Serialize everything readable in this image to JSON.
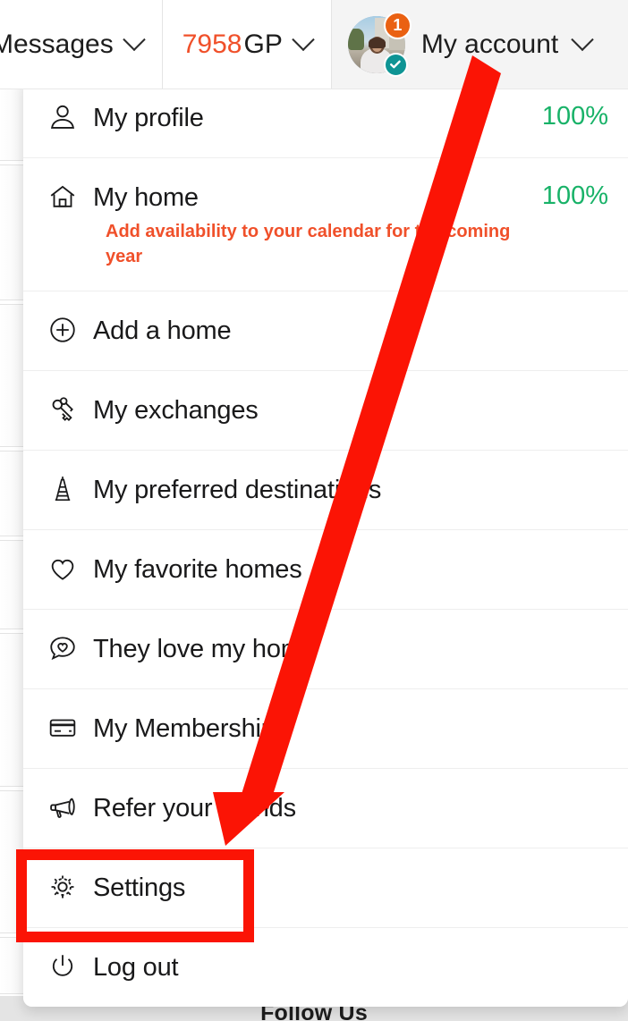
{
  "header": {
    "messages_label": "Messages",
    "gp_value": "7958",
    "gp_unit": "GP",
    "account_label": "My account",
    "avatar_badge_count": "1",
    "verified_icon": "check-icon",
    "messages_chevron": "chevron-down-icon",
    "gp_chevron": "chevron-down-icon",
    "account_chevron": "chevron-down-icon"
  },
  "dropdown": {
    "items": [
      {
        "label": "My profile",
        "icon": "user-icon",
        "meta": "100%"
      },
      {
        "label": "My home",
        "icon": "house-icon",
        "meta": "100%",
        "note": "Add availability to your calendar for the coming year"
      },
      {
        "label": "Add a home",
        "icon": "plus-circle-icon",
        "meta": ""
      },
      {
        "label": "My exchanges",
        "icon": "keys-icon",
        "meta": ""
      },
      {
        "label": "My preferred destinations",
        "icon": "eiffel-tower-icon",
        "meta": ""
      },
      {
        "label": "My favorite homes",
        "icon": "heart-icon",
        "meta": ""
      },
      {
        "label": "They love my home",
        "icon": "chat-heart-icon",
        "meta": ""
      },
      {
        "label": "My Membership",
        "icon": "credit-card-icon",
        "meta": ""
      },
      {
        "label": "Refer your friends",
        "icon": "megaphone-icon",
        "meta": ""
      },
      {
        "label": "Settings",
        "icon": "gear-icon",
        "meta": ""
      },
      {
        "label": "Log out",
        "icon": "power-icon",
        "meta": ""
      }
    ]
  },
  "footer": {
    "follow_us_label": "Follow Us"
  },
  "annotations": {
    "arrow_color": "#fb1405",
    "highlight_color": "#fb1405",
    "highlighted_item": "Settings"
  },
  "colors": {
    "accent_orange": "#f0502a",
    "badge_orange": "#ea6112",
    "verified_teal": "#0e9494",
    "percent_green": "#18b268",
    "text_dark": "#19191a",
    "annotation_red": "#fb1405"
  }
}
